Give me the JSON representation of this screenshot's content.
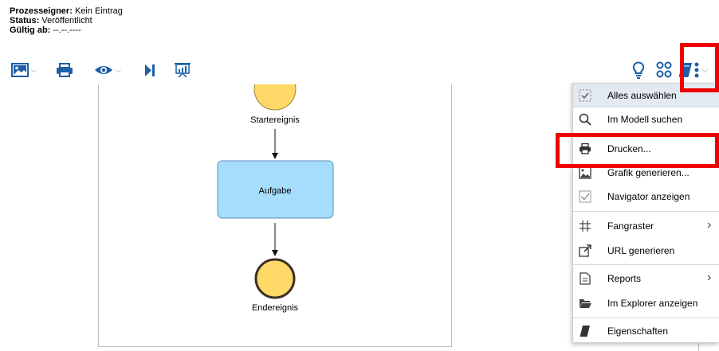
{
  "meta": {
    "owner_label": "Prozesseigner:",
    "owner_value": "Kein Eintrag",
    "status_label": "Status:",
    "status_value": "Veröffentlicht",
    "valid_label": "Gültig ab:",
    "valid_value": "--.--.----"
  },
  "toolbar": {
    "left_icons": [
      "image-icon",
      "printer-icon",
      "eye-icon",
      "step-forward-icon",
      "presentation-icon"
    ],
    "right_icons": [
      "lightbulb-icon",
      "loop-icon",
      "book-icon",
      "more-vertical-icon"
    ]
  },
  "diagram": {
    "start_event": "Startereignis",
    "task": "Aufgabe",
    "end_event": "Endereignis",
    "event_fill": "#ffd868",
    "task_fill": "#a6dcfc"
  },
  "menu": {
    "items": [
      {
        "label": "Alles auswählen",
        "icon": "select-all-icon"
      },
      {
        "label": "Im Modell suchen",
        "icon": "search-icon"
      },
      {
        "label": "Drucken...",
        "icon": "printer-icon"
      },
      {
        "label": "Grafik generieren...",
        "icon": "image-icon"
      },
      {
        "label": "Navigator anzeigen",
        "icon": "checkmark-icon"
      },
      {
        "label": "Fangraster",
        "icon": "grid-icon"
      },
      {
        "label": "URL generieren",
        "icon": "external-link-icon"
      },
      {
        "label": "Reports",
        "icon": "document-icon"
      },
      {
        "label": "Im Explorer anzeigen",
        "icon": "folder-open-icon"
      },
      {
        "label": "Eigenschaften",
        "icon": "book-icon"
      }
    ]
  },
  "colors": {
    "accent_blue": "#1d5fa8",
    "highlight_red": "#ee0000"
  }
}
